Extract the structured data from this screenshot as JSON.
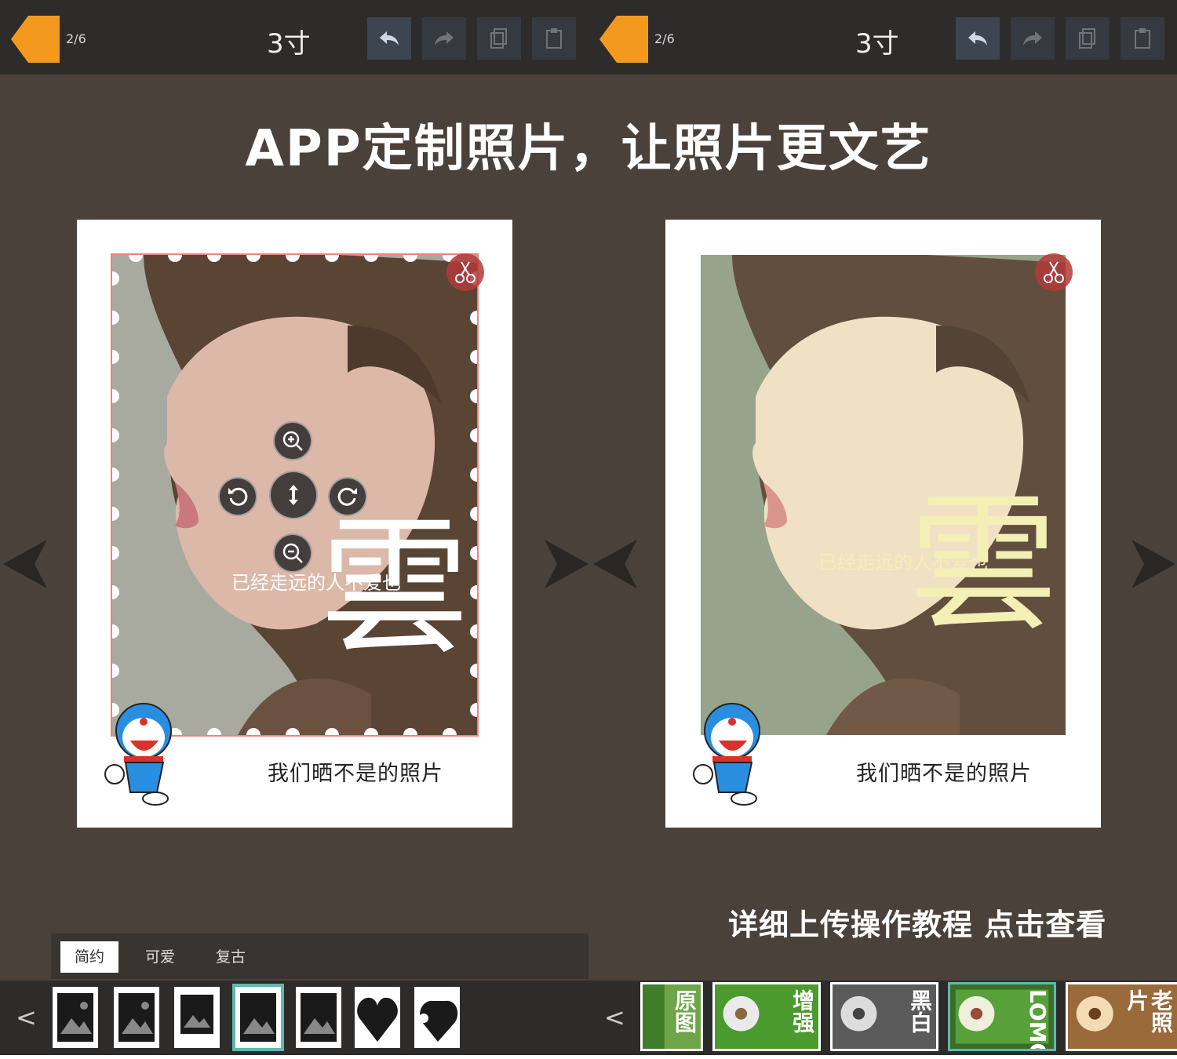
{
  "headline": "APP定制照片，让照片更文艺",
  "panels": [
    {
      "page_indicator": "2/6",
      "print_size": "3寸",
      "caption": "我们晒不是的照片",
      "overlay_char": "雲",
      "overlay_line": "已经走远的人不爱也",
      "tabs": [
        {
          "label": "简约",
          "active": true
        },
        {
          "label": "可爱",
          "active": false
        },
        {
          "label": "复古",
          "active": false
        }
      ]
    },
    {
      "page_indicator": "2/6",
      "print_size": "3寸",
      "caption": "我们晒不是的照片",
      "overlay_char": "雲",
      "overlay_line": "已经走远的人不爱也",
      "tutorial_link": "详细上传操作教程 点击查看",
      "filters": [
        {
          "label": "原图",
          "tone": "#5f9a3c"
        },
        {
          "label": "增强",
          "tone": "#3f8a2a"
        },
        {
          "label": "黑白",
          "tone": "#6a6a6a"
        },
        {
          "label": "LOMO",
          "tone": "#4e8f3a"
        },
        {
          "label": "老照片",
          "tone": "#9b6a3a"
        }
      ]
    }
  ],
  "icons": {
    "back": "back-arrow-icon",
    "undo": "undo-icon",
    "redo": "redo-icon",
    "copy": "copy-icon",
    "paste": "paste-icon",
    "crop": "scissors-icon",
    "zoom_in": "zoom-in-icon",
    "zoom_out": "zoom-out-icon",
    "rotate_left": "rotate-left-icon",
    "rotate_right": "rotate-right-icon",
    "move": "move-icon"
  },
  "colors": {
    "background": "#4a413a",
    "topbar": "#2e2c2b",
    "back_button": "#f39a1e",
    "selected": "#5fb8b0"
  },
  "strip_prev": "<"
}
